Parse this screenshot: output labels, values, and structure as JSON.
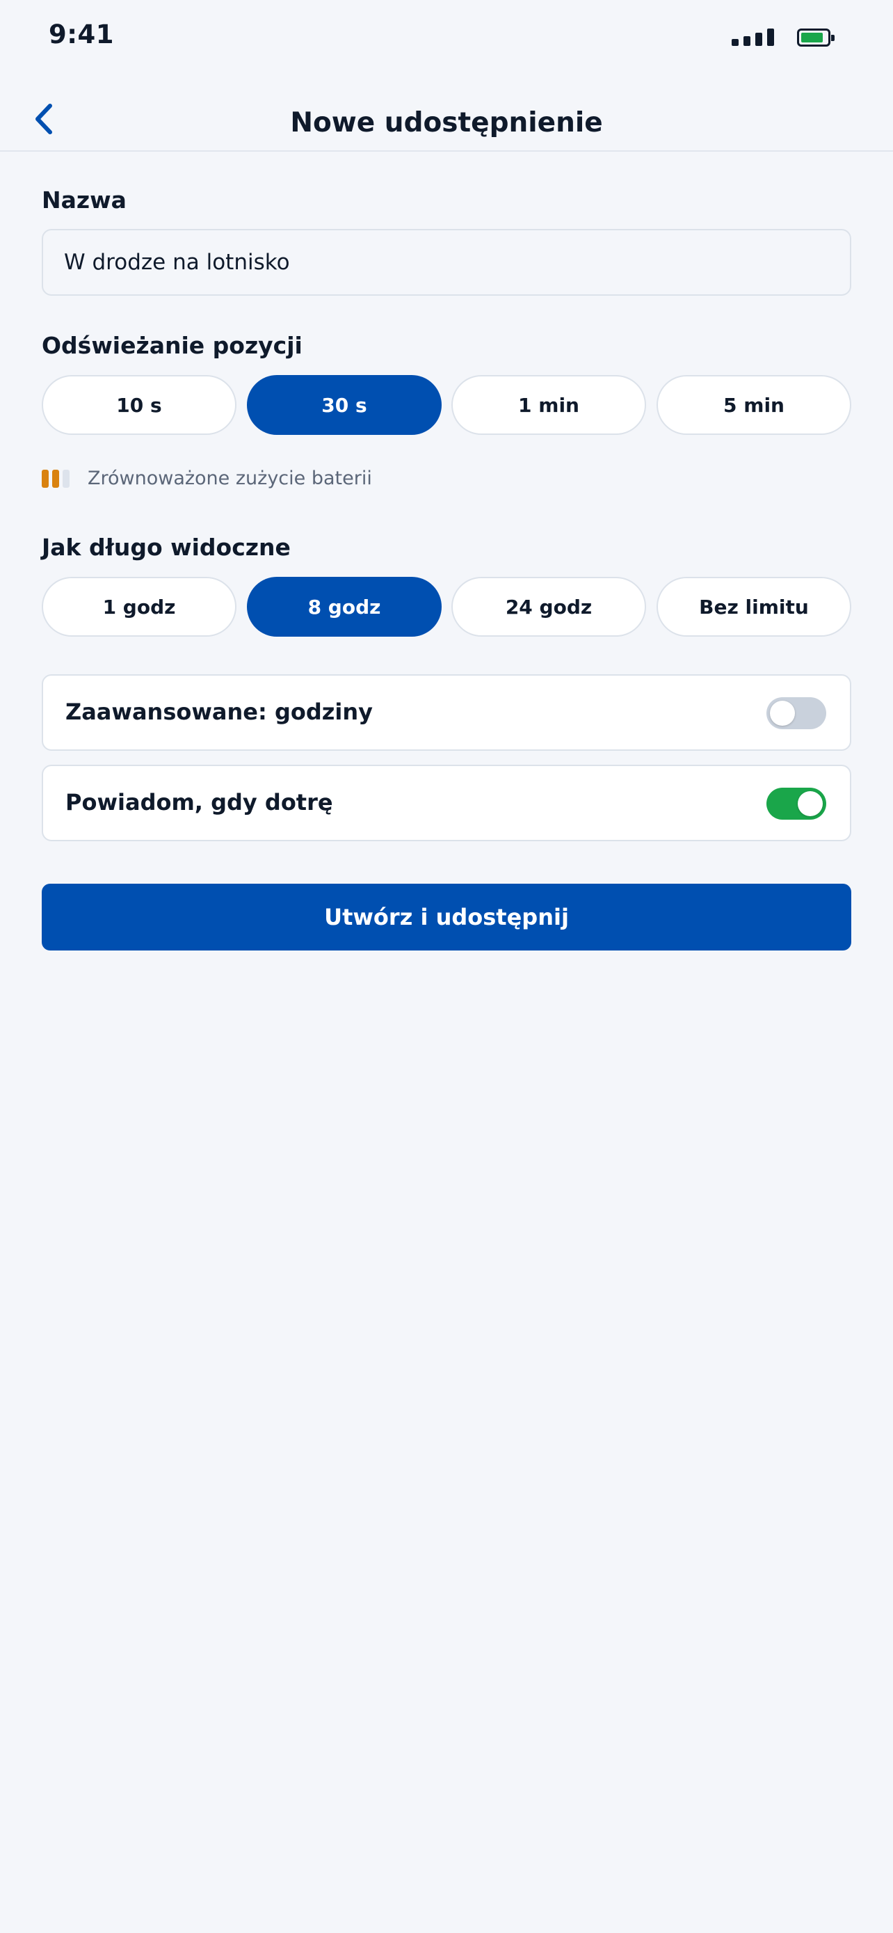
{
  "status_bar": {
    "time": "9:41",
    "signal_icon": "cellular-signal-icon",
    "battery_icon": "battery-icon",
    "battery_level": 0.85,
    "battery_color": "#1AA64A"
  },
  "nav": {
    "back_icon": "chevron-left-icon",
    "title": "Nowe udostępnienie"
  },
  "name_section": {
    "label": "Nazwa",
    "value": "W drodze na lotnisko"
  },
  "refresh_section": {
    "label": "Odświeżanie pozycji",
    "options": [
      {
        "label": "10 s",
        "selected": false
      },
      {
        "label": "30 s",
        "selected": true
      },
      {
        "label": "1 min",
        "selected": false
      },
      {
        "label": "5 min",
        "selected": false
      }
    ],
    "battery_hint_icon": "battery-usage-bars-icon",
    "battery_hint_level": "2 of 3",
    "battery_hint": "Zrównoważone zużycie baterii"
  },
  "duration_section": {
    "label": "Jak długo widoczne",
    "options": [
      {
        "label": "1 godz",
        "selected": false
      },
      {
        "label": "8 godz",
        "selected": true
      },
      {
        "label": "24 godz",
        "selected": false
      },
      {
        "label": "Bez limitu",
        "selected": false
      }
    ]
  },
  "toggles": [
    {
      "label": "Zaawansowane: godziny",
      "on": false
    },
    {
      "label": "Powiadom, gdy dotrę",
      "on": true
    }
  ],
  "primary_button": {
    "label": "Utwórz i udostępnij"
  },
  "colors": {
    "accent": "#004FB0",
    "background": "#F4F6FA",
    "toggle_on": "#1AA64A",
    "toggle_off": "#C9D1DC",
    "battery_hint_active": "#D9820F"
  }
}
